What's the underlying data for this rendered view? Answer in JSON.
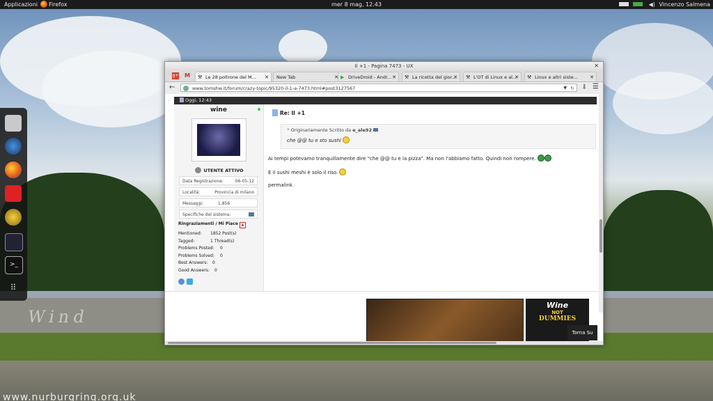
{
  "topbar": {
    "apps_label": "Applicazioni",
    "firefox_label": "Firefox",
    "clock": "mer  8 mag, 12.43",
    "user": "Vincenzo Salmena"
  },
  "dock": {
    "items": [
      "files-icon",
      "globe-icon",
      "firefox-icon",
      "media-player-icon",
      "speaker-icon",
      "system-monitor-icon",
      "terminal-icon",
      "app-grid-icon"
    ]
  },
  "desktop": {
    "watermark": "www.nurburgring.org.uk",
    "track_text": "Wind"
  },
  "window": {
    "title": "Il +1 - Pagina 7473 - UX",
    "tabs": [
      {
        "label": "Le 28 poltrone del M..."
      },
      {
        "label": "New Tab"
      },
      {
        "label": "DriveDroid - Andr..."
      },
      {
        "label": "La ricetta del gior..."
      },
      {
        "label": "L'OT di Linux e al..."
      },
      {
        "label": "Linux e altri siste..."
      }
    ],
    "url": "www.tomshw.it/forum/crazy-topic/95320-il-1-a-7473.html#post3127567"
  },
  "post": {
    "date": "Oggi, 12:43",
    "username": "wine",
    "user_status": "UTENTE ATTIVO",
    "info": [
      {
        "label": "Data Registrazione:",
        "value": "06-05-12"
      },
      {
        "label": "Località:",
        "value": "Provincia di milano"
      },
      {
        "label": "Messaggi:",
        "value": "1,856"
      },
      {
        "label": "Specifiche del sistema:",
        "value": ""
      }
    ],
    "thanks_heading": "Ringraziamenti / Mi Piace",
    "stats": [
      {
        "label": "Mentioned:",
        "value": "1852 Post(s)"
      },
      {
        "label": "Tagged:",
        "value": "1 Thread(s)"
      },
      {
        "label": "Problems Posted:",
        "value": "0"
      },
      {
        "label": "Problems Solved:",
        "value": "0"
      },
      {
        "label": "Best Answers:",
        "value": "0"
      },
      {
        "label": "Good Answers:",
        "value": "0"
      }
    ],
    "title": "Re: Il +1",
    "quote_header": "Originariamente Scritto da",
    "quote_author": "e_ale92",
    "quote_text": "che @@ tu e sto sushi",
    "body_line1": "Ai tempi potevamo tranquillamente dire \"che @@ tu e la pizza\". Ma non l'abbiamo fatto. Quindi non rompere.",
    "body_line2": "E il sushi meshi è solo il riso.",
    "permalink": "permalink",
    "ad_book_title1": "Wine",
    "ad_book_title2": "NOT",
    "ad_book_title3": "DUMMIES",
    "back_to_top": "Torna Su"
  }
}
